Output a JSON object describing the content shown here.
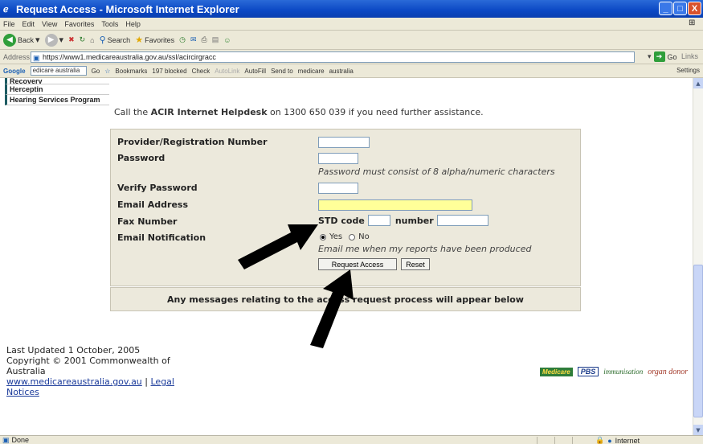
{
  "window": {
    "title": "Request Access - Microsoft Internet Explorer",
    "buttons": {
      "minimize": "_",
      "maximize": "□",
      "close": "X"
    }
  },
  "menu": [
    "File",
    "Edit",
    "View",
    "Favorites",
    "Tools",
    "Help"
  ],
  "toolbar": {
    "back": "Back",
    "search": "Search",
    "favorites": "Favorites"
  },
  "address": {
    "label": "Address",
    "url": "https://www1.medicareaustralia.gov.au/ssl/acircirgracc",
    "go": "Go",
    "links": "Links"
  },
  "google_bar": {
    "logo": "Google",
    "search_value": "edicare australia",
    "go": "Go",
    "bookmarks": "Bookmarks",
    "blocked": "197 blocked",
    "check": "Check",
    "autolink": "AutoLink",
    "autofill": "AutoFill",
    "send_to": "Send to",
    "term1": "medicare",
    "term2": "australia",
    "settings": "Settings"
  },
  "sidebar": {
    "items": [
      {
        "label": "Recovery"
      },
      {
        "label": "Herceptin"
      },
      {
        "label": "Hearing Services Program"
      }
    ]
  },
  "help": {
    "prefix": "Call the",
    "bold": "ACIR Internet Helpdesk",
    "suffix": "on 1300 650 039 if you need further assistance."
  },
  "form": {
    "provider_label": "Provider/Registration Number",
    "password_label": "Password",
    "password_note": "Password must consist of 8 alpha/numeric characters",
    "verify_label": "Verify Password",
    "email_label": "Email Address",
    "fax_label": "Fax Number",
    "std_label": "STD code",
    "number_label": "number",
    "notify_label": "Email Notification",
    "yes": "Yes",
    "no": "No",
    "notify_note": "Email me when my reports have been produced",
    "submit": "Request Access",
    "reset": "Reset",
    "values": {
      "provider": "",
      "password": "",
      "verify": "",
      "email": "",
      "std": "",
      "number": ""
    },
    "notification_selected": "Yes"
  },
  "messages": "Any messages relating to the access request process will appear below",
  "footer": {
    "updated": "Last Updated 1 October, 2005",
    "copyright": "Copyright © 2001 Commonwealth of Australia",
    "site_link": "www.medicareaustralia.gov.au",
    "separator": "|",
    "legal_link": "Legal Notices"
  },
  "logos": {
    "medicare": "Medicare",
    "pbs": "PBS",
    "immunisation": "immunisation",
    "organ": "organ donor"
  },
  "status": {
    "left": "Done",
    "zone": "Internet"
  },
  "colors": {
    "title_bar": "#0b48c4",
    "form_bg": "#ece9dc",
    "email_highlight": "#ffff99",
    "arrow": "#000000"
  }
}
